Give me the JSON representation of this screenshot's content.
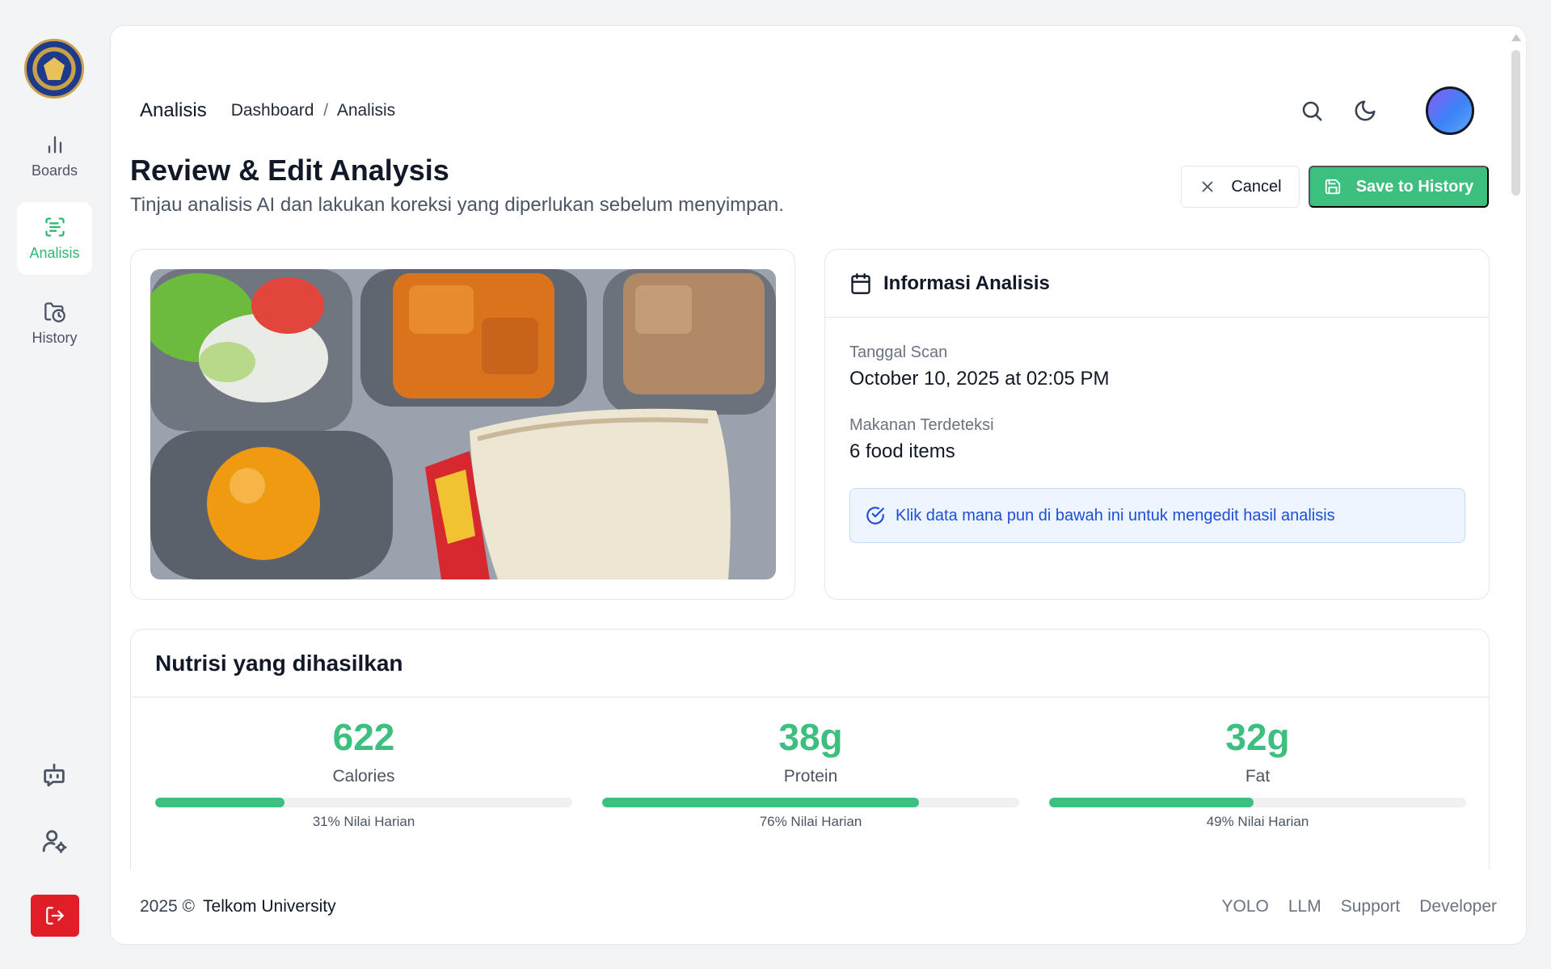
{
  "sidebar": {
    "logo_icon": "garuda-emblem-icon",
    "items": [
      {
        "label": "Boards",
        "icon": "bar-chart-icon",
        "active": false
      },
      {
        "label": "Analisis",
        "icon": "scan-text-icon",
        "active": true
      },
      {
        "label": "History",
        "icon": "folder-clock-icon",
        "active": false
      }
    ],
    "bottom_icons": [
      "bot-message-icon",
      "user-settings-icon",
      "logout-icon"
    ]
  },
  "header": {
    "title": "Analisis",
    "breadcrumb": {
      "parent": "Dashboard",
      "separator": "/",
      "current": "Analisis"
    }
  },
  "page": {
    "title": "Review & Edit Analysis",
    "subtitle": "Tinjau analisis AI dan lakukan koreksi yang diperlukan sebelum menyimpan.",
    "cancel_label": "Cancel",
    "save_label": "Save to History"
  },
  "info": {
    "title": "Informasi Analisis",
    "scan_label": "Tanggal Scan",
    "scan_value": "October 10, 2025 at 02:05 PM",
    "detected_label": "Makanan Terdeteksi",
    "detected_value": "6 food items",
    "note": "Klik data mana pun di bawah ini untuk mengedit hasil analisis"
  },
  "nutrition": {
    "title": "Nutrisi yang dihasilkan",
    "items": [
      {
        "value": "622",
        "label": "Calories",
        "percent": 31,
        "percent_label": "31% Nilai Harian"
      },
      {
        "value": "38g",
        "label": "Protein",
        "percent": 76,
        "percent_label": "76% Nilai Harian"
      },
      {
        "value": "32g",
        "label": "Fat",
        "percent": 49,
        "percent_label": "49% Nilai Harian"
      }
    ]
  },
  "footer": {
    "year": "2025 ©",
    "org": "Telkom University",
    "links": [
      "YOLO",
      "LLM",
      "Support",
      "Developer"
    ]
  },
  "colors": {
    "accent": "#3dbf7f",
    "danger": "#e11d27",
    "info_blue": "#1d4ed8"
  }
}
